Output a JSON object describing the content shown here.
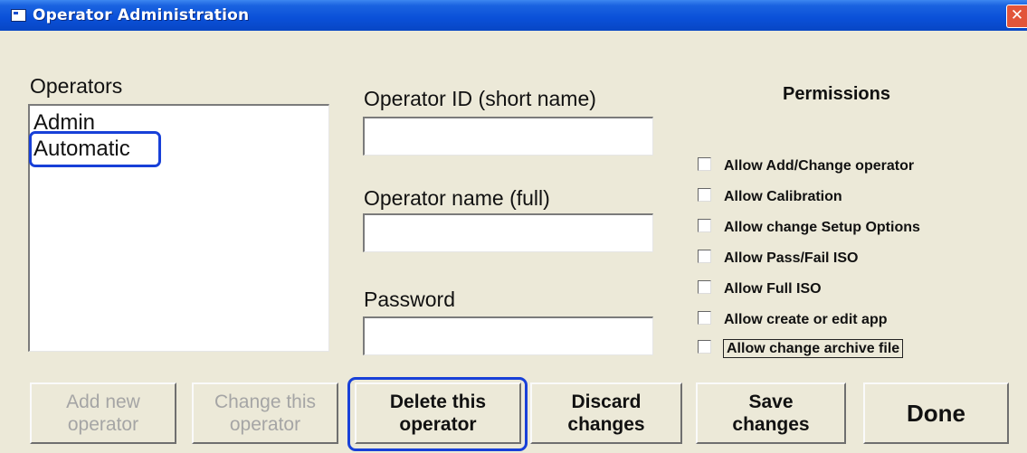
{
  "window": {
    "title": "Operator Administration",
    "close_glyph": "✕"
  },
  "operators": {
    "label": "Operators",
    "items": [
      "Admin",
      "Automatic"
    ],
    "highlighted": "Automatic"
  },
  "fields": {
    "operator_id": {
      "label": "Operator ID (short name)",
      "value": ""
    },
    "operator_name": {
      "label": "Operator name (full)",
      "value": ""
    },
    "password": {
      "label": "Password",
      "value": ""
    }
  },
  "permissions": {
    "title": "Permissions",
    "items": [
      {
        "label": "Allow Add/Change operator",
        "checked": false
      },
      {
        "label": "Allow Calibration",
        "checked": false
      },
      {
        "label": "Allow change Setup Options",
        "checked": false
      },
      {
        "label": "Allow Pass/Fail ISO",
        "checked": false
      },
      {
        "label": "Allow Full ISO",
        "checked": false
      },
      {
        "label": "Allow create or edit app",
        "checked": false
      },
      {
        "label": "Allow change archive file",
        "checked": false
      }
    ]
  },
  "buttons": {
    "add_new": {
      "line1": "Add new",
      "line2": "operator",
      "enabled": false
    },
    "change": {
      "line1": "Change this",
      "line2": "operator",
      "enabled": false
    },
    "delete": {
      "line1": "Delete this",
      "line2": "operator",
      "enabled": true
    },
    "discard": {
      "line1": "Discard",
      "line2": "changes",
      "enabled": true
    },
    "save": {
      "line1": "Save",
      "line2": "changes",
      "enabled": true
    },
    "done": {
      "label": "Done",
      "enabled": true
    }
  },
  "colors": {
    "title_bar": "#0a50d8",
    "highlight": "#1840d8",
    "dialog_bg": "#ece9d8",
    "disabled_text": "#a5a5a5"
  }
}
